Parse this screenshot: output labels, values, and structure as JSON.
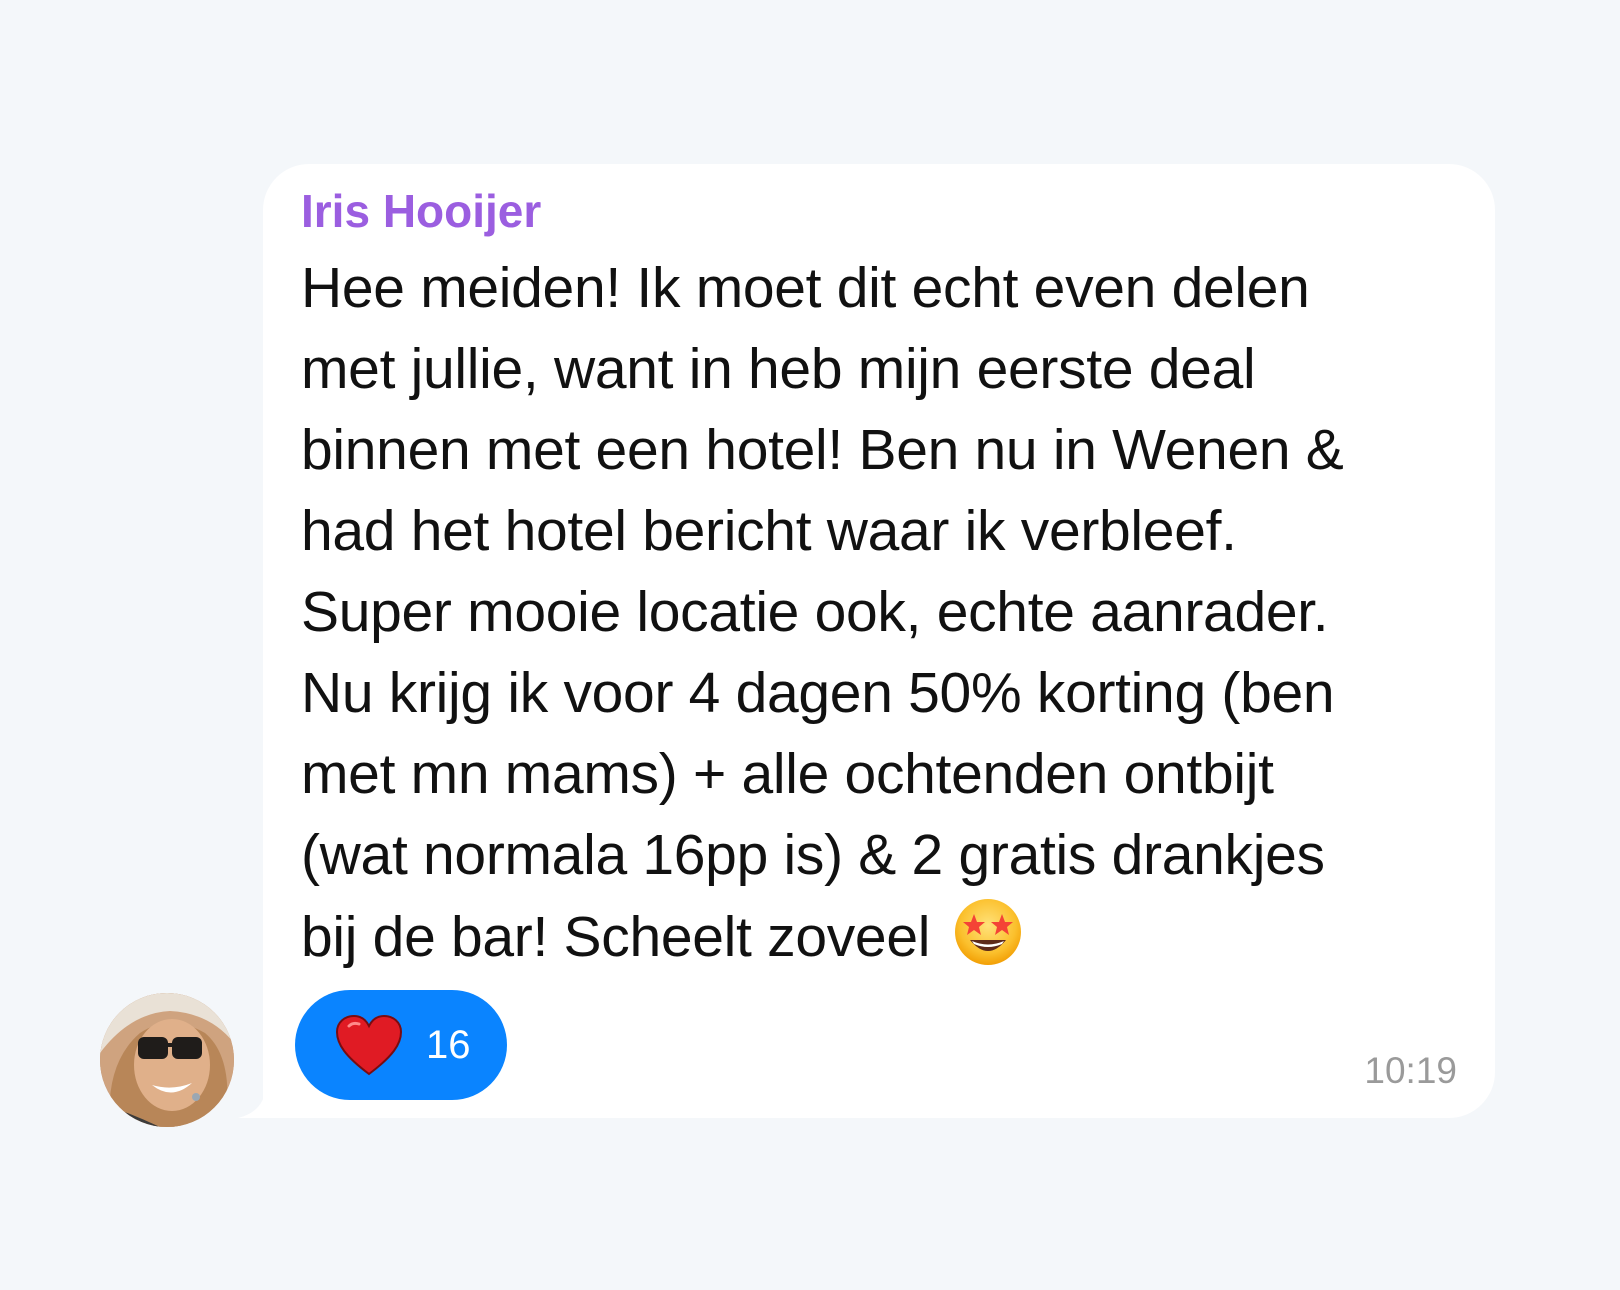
{
  "message": {
    "sender_name": "Iris Hooijer",
    "sender_color": "#9b5ee0",
    "lines": [
      "Hee meiden! Ik moet dit echt even delen",
      "met jullie, want in heb mijn eerste deal",
      "binnen met een hotel! Ben nu in Wenen &",
      "had het hotel bericht waar ik verbleef.",
      "Super mooie locatie ook, echte aanrader.",
      "Nu krijg ik voor 4 dagen 50% korting (ben",
      "met mn mams) + alle ochtenden ontbijt",
      "(wat normala 16pp is) & 2 gratis drankjes",
      "bij de bar! Scheelt zoveel"
    ],
    "trailing_emoji": "star-struck-emoji",
    "timestamp": "10:19"
  },
  "reaction": {
    "icon": "heart-icon",
    "count": "16",
    "color": "#0a84ff"
  },
  "avatar": {
    "icon": "avatar-photo"
  }
}
